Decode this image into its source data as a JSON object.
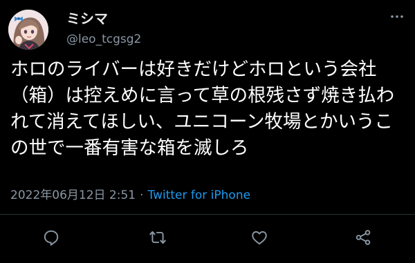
{
  "user": {
    "display_name": "ミシマ",
    "handle": "@leo_tcgsg2",
    "avatar_icon": "avatar-image"
  },
  "tweet": {
    "text": "ホロのライバーは好きだけどホロという会社（箱）は控えめに言って草の根残さず焼き払われて消えてほしい、ユニコーン牧場とかいうこの世で一番有害な箱を滅しろ",
    "timestamp": "2022年06月12日 2:51",
    "separator": "·",
    "source": "Twitter for iPhone"
  },
  "actions": [
    {
      "name": "reply",
      "icon": "reply-icon"
    },
    {
      "name": "retweet",
      "icon": "retweet-icon"
    },
    {
      "name": "like",
      "icon": "heart-icon"
    },
    {
      "name": "share",
      "icon": "share-icon"
    }
  ],
  "colors": {
    "background": "#000000",
    "text": "#ffffff",
    "secondary": "#8b98a5",
    "accent": "#1d9bf0",
    "divider": "#2f3336"
  }
}
